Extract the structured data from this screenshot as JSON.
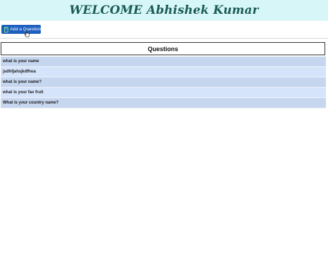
{
  "header": {
    "title": "WELCOME Abhishek Kumar"
  },
  "toolbar": {
    "add_question_label": "Add a Question",
    "add_icon_glyph": "+"
  },
  "questions": {
    "heading": "Questions",
    "items": [
      "what is your name",
      "jsdhfjahsjkdfhoa",
      "what is your name?",
      "what is your fav fruit",
      "What is your country name?"
    ]
  },
  "colors": {
    "header_bg": "#d7f6f7",
    "header_text": "#1a5b57",
    "button_bg": "#1c5fbf",
    "row_odd": "#c6d6ef",
    "row_even": "#d6e4fb"
  },
  "icons": {
    "add": "plus-square-icon",
    "cursor": "pointer-hand-icon"
  }
}
